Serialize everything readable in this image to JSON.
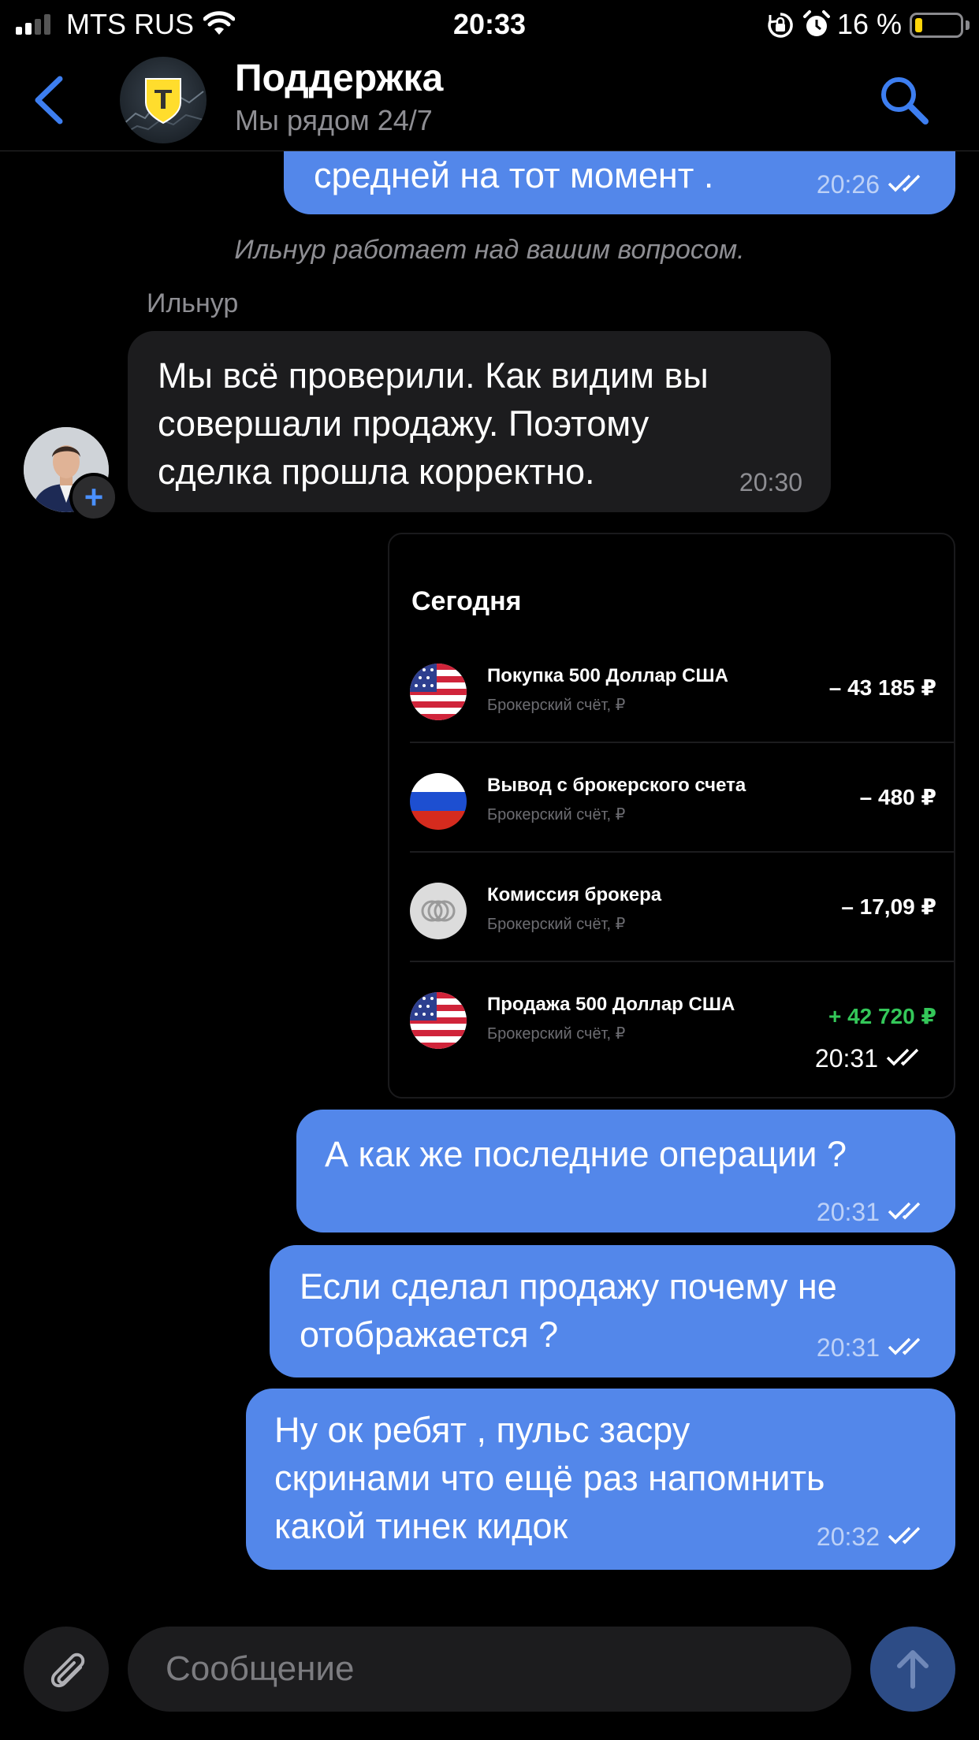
{
  "status_bar": {
    "carrier": "MTS RUS",
    "time": "20:33",
    "battery_percent": "16 %",
    "battery_level": 0.16
  },
  "header": {
    "title": "Поддержка",
    "subtitle": "Мы рядом 24/7"
  },
  "messages": {
    "top_partial": {
      "text": "средней на тот момент .",
      "time": "20:26"
    },
    "system": "Ильнур работает над вашим вопросом.",
    "agent_name": "Ильнур",
    "agent_msg": {
      "lines": [
        "Мы всё проверили. Как видим вы",
        "совершали продажу. Поэтому",
        "сделка прошла корректно."
      ],
      "time": "20:30"
    },
    "screenshot": {
      "title": "Сегодня",
      "time": "20:31",
      "transactions": [
        {
          "name": "Покупка 500 Доллар США",
          "sub": "Брокерский счёт, ₽",
          "amount": "– 43 185 ₽",
          "icon": "us-flag-icon"
        },
        {
          "name": "Вывод с брокерского счета",
          "sub": "Брокерский счёт, ₽",
          "amount": "– 480 ₽",
          "icon": "ru-flag-icon"
        },
        {
          "name": "Комиссия брокера",
          "sub": "Брокерский счёт, ₽",
          "amount": "– 17,09 ₽",
          "icon": "coins-icon"
        },
        {
          "name": "Продажа 500 Доллар США",
          "sub": "Брокерский счёт, ₽",
          "amount": "+ 42 720 ₽",
          "icon": "us-flag-icon"
        }
      ]
    },
    "out_1": {
      "text": "А как же последние операции ?",
      "time": "20:31"
    },
    "out_2": {
      "lines": [
        "Если сделал продажу почему не",
        "отображается ?"
      ],
      "time": "20:31"
    },
    "out_3": {
      "lines": [
        "Ну ок ребят , пульс засру",
        "скринами что ещё раз напомнить",
        "какой тинек кидок"
      ],
      "time": "20:32"
    }
  },
  "input": {
    "placeholder": "Сообщение"
  },
  "colors": {
    "outgoing_bubble": "#5387ea",
    "incoming_bubble": "#1c1c1e",
    "accent": "#3d7ef0",
    "positive_amount": "#34c759"
  }
}
